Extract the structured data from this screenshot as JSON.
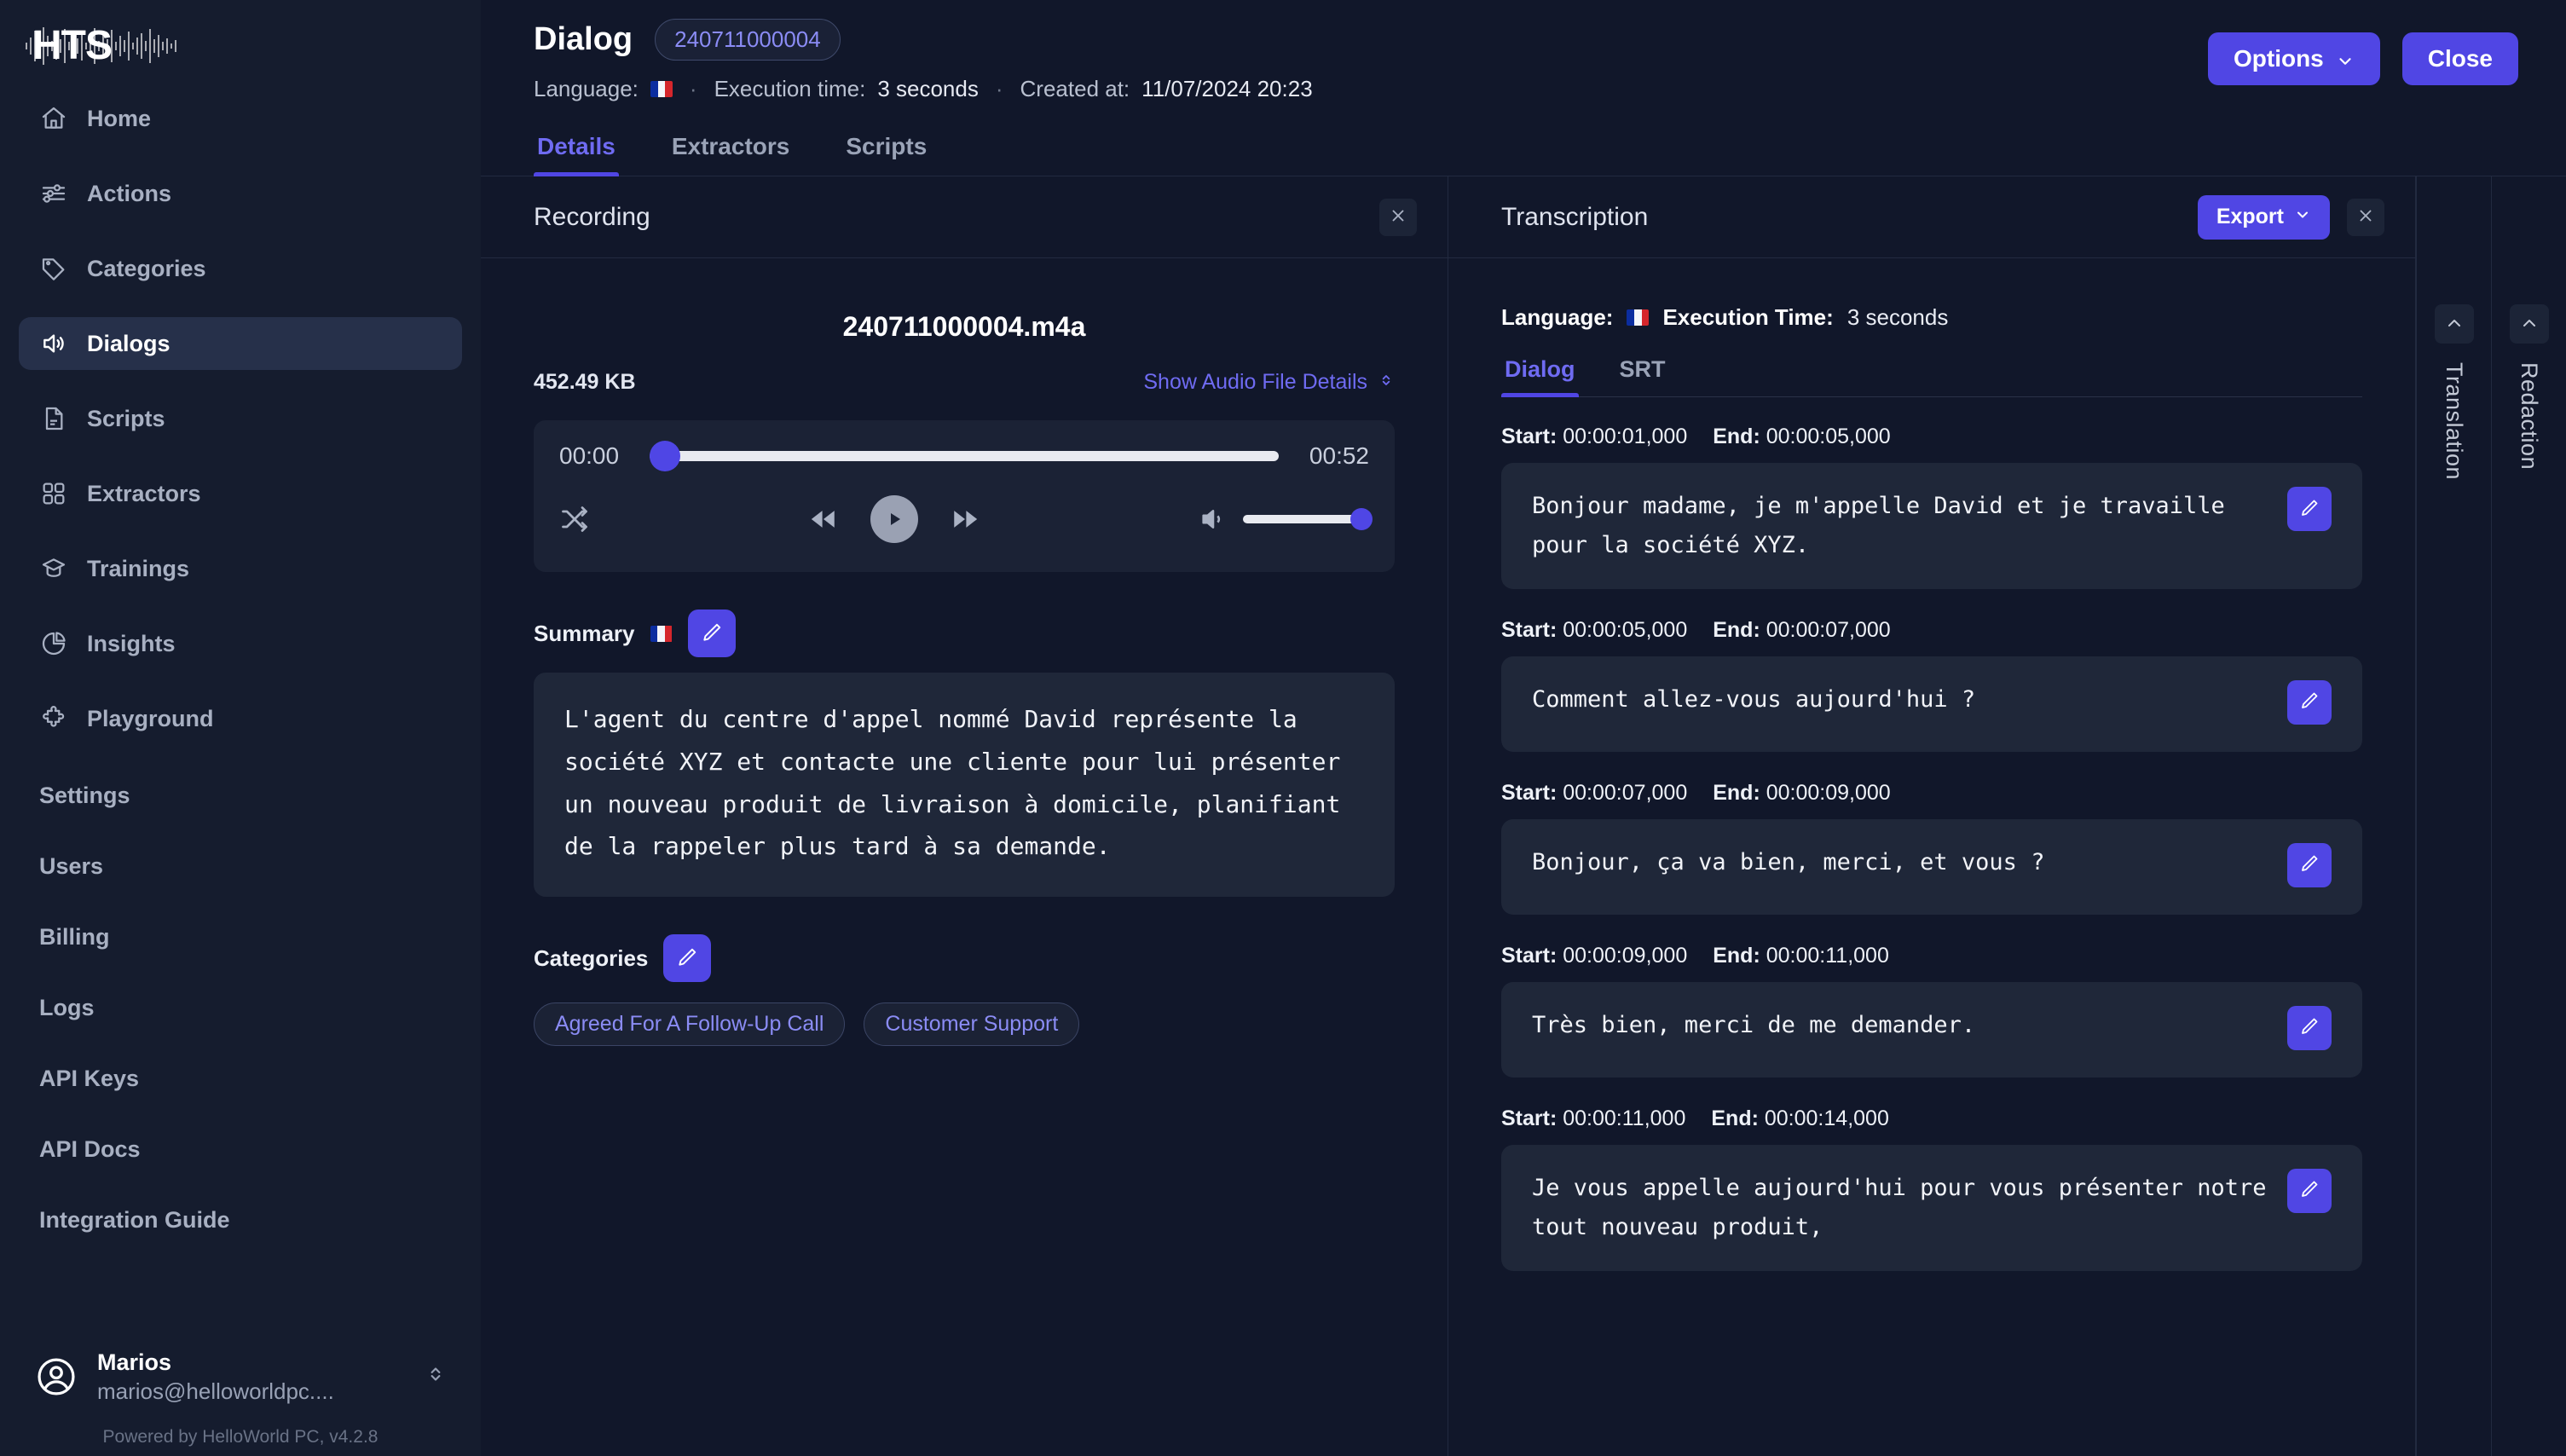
{
  "brand": {
    "logo_text": "HTS",
    "powered_by": "Powered by HelloWorld PC, v4.2.8"
  },
  "sidebar": {
    "items": [
      {
        "label": "Home",
        "icon": "home-icon"
      },
      {
        "label": "Actions",
        "icon": "sliders-icon"
      },
      {
        "label": "Categories",
        "icon": "tag-icon"
      },
      {
        "label": "Dialogs",
        "icon": "speaker-icon",
        "active": true
      },
      {
        "label": "Scripts",
        "icon": "document-icon"
      },
      {
        "label": "Extractors",
        "icon": "grid-icon"
      },
      {
        "label": "Trainings",
        "icon": "graduation-cap-icon"
      },
      {
        "label": "Insights",
        "icon": "pie-chart-icon"
      },
      {
        "label": "Playground",
        "icon": "puzzle-icon"
      }
    ],
    "sub_items": [
      {
        "label": "Settings"
      },
      {
        "label": "Users"
      },
      {
        "label": "Billing"
      },
      {
        "label": "Logs"
      },
      {
        "label": "API Keys"
      },
      {
        "label": "API Docs"
      },
      {
        "label": "Integration Guide"
      }
    ],
    "profile": {
      "name": "Marios",
      "email": "marios@helloworldpc...."
    }
  },
  "header": {
    "title": "Dialog",
    "id_chip": "240711000004",
    "language_label": "Language:",
    "language_flag": "fr-flag-icon",
    "execution_label": "Execution time:",
    "execution_value": "3 seconds",
    "created_label": "Created at:",
    "created_value": "11/07/2024 20:23",
    "options_button": "Options",
    "close_button": "Close"
  },
  "tabs": [
    {
      "label": "Details",
      "active": true
    },
    {
      "label": "Extractors",
      "active": false
    },
    {
      "label": "Scripts",
      "active": false
    }
  ],
  "recording": {
    "panel_title": "Recording",
    "filename": "240711000004.m4a",
    "filesize": "452.49 KB",
    "details_link": "Show Audio File Details",
    "player": {
      "current_time": "00:00",
      "total_time": "00:52",
      "progress_percent": 0,
      "volume_percent": 100
    },
    "summary_label": "Summary",
    "summary_text": "L'agent du centre d'appel nommé David représente la société XYZ et contacte une cliente pour lui présenter un nouveau produit de livraison à domicile, planifiant de la rappeler plus tard à sa demande.",
    "categories_label": "Categories",
    "categories": [
      "Agreed For A Follow-Up Call",
      "Customer Support"
    ]
  },
  "transcription": {
    "panel_title": "Transcription",
    "export_button": "Export",
    "language_label": "Language:",
    "execution_label": "Execution Time:",
    "execution_value": "3 seconds",
    "tabs": [
      {
        "label": "Dialog",
        "active": true
      },
      {
        "label": "SRT",
        "active": false
      }
    ],
    "start_label": "Start:",
    "end_label": "End:",
    "segments": [
      {
        "start": "00:00:01,000",
        "end": "00:00:05,000",
        "text": "Bonjour madame, je m'appelle David et je travaille pour la société XYZ."
      },
      {
        "start": "00:00:05,000",
        "end": "00:00:07,000",
        "text": "Comment allez-vous aujourd'hui ?"
      },
      {
        "start": "00:00:07,000",
        "end": "00:00:09,000",
        "text": "Bonjour, ça va bien, merci, et vous ?"
      },
      {
        "start": "00:00:09,000",
        "end": "00:00:11,000",
        "text": "Très bien, merci de me demander."
      },
      {
        "start": "00:00:11,000",
        "end": "00:00:14,000",
        "text": "Je vous appelle aujourd'hui pour vous présenter notre tout nouveau produit,"
      }
    ]
  },
  "rails": [
    {
      "label": "Translation"
    },
    {
      "label": "Redaction"
    }
  ],
  "colors": {
    "accent": "#5046e4",
    "accent_text": "#8b8cf5",
    "bg": "#11172a",
    "sidebar_bg": "#151c2e",
    "panel_card": "#1f2739"
  }
}
